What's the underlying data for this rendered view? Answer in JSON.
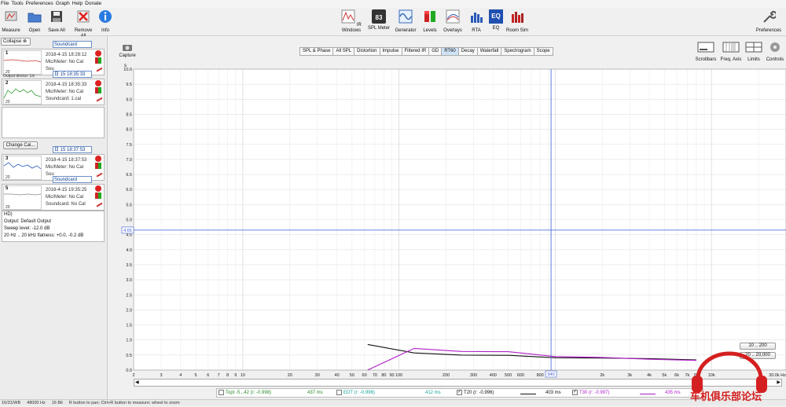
{
  "menu": [
    "File",
    "Tools",
    "Preferences",
    "Graph",
    "Help",
    "Donate"
  ],
  "toolbar_left": [
    {
      "label": "Measure",
      "icon": "microphone-icon"
    },
    {
      "label": "Open",
      "icon": "open-folder-icon"
    },
    {
      "label": "Save All",
      "icon": "save-icon"
    },
    {
      "label": "Remove All",
      "icon": "remove-all-icon"
    },
    {
      "label": "Info",
      "icon": "info-icon"
    }
  ],
  "toolbar_center": [
    {
      "label": "IR Windows",
      "icon": "ir-windows-icon"
    },
    {
      "label": "SPL Meter",
      "icon": "spl-meter-icon",
      "value": "83"
    },
    {
      "label": "Generator",
      "icon": "generator-icon"
    },
    {
      "label": "Levels",
      "icon": "levels-icon"
    },
    {
      "label": "Overlays",
      "icon": "overlays-icon"
    },
    {
      "label": "RTA",
      "icon": "rta-icon"
    },
    {
      "label": "EQ",
      "icon": "eq-icon"
    },
    {
      "label": "Room Sim",
      "icon": "room-sim-icon"
    }
  ],
  "preferences_label": "Preferences",
  "left_panel": {
    "collapse_label": "Collapse",
    "change_cal_label": "Change Cal...",
    "measurements": [
      {
        "num": "1",
        "date_input": "Soundcard",
        "date": "2018-4-15 18:28:12",
        "mic": "Mic/Meter: No Cal",
        "sound": "Sou",
        "thumb_lbl": "20",
        "extra": "Output device: Lin"
      },
      {
        "num": "2",
        "date_input": "日  15 18:35:33",
        "date": "2018-4-15 18:35:33",
        "mic": "Mic/Meter: No Cal",
        "sound": "Soundcard: 1.cal",
        "thumb_lbl": "20"
      },
      {
        "num": "3",
        "date_input": "日  15 18:37:53",
        "date": "2018-4-15 18:37:53",
        "mic": "Mic/Meter: No Cal",
        "sound": "Sou",
        "thumb_lbl": "20"
      },
      {
        "num": "5",
        "date_input": "Soundcard",
        "date": "2018-4-15 19:35:25",
        "mic": "Mic/Meter: No Cal",
        "sound": "Soundcard: No Cal",
        "thumb_lbl": "20"
      }
    ],
    "desc_lines": [
      "HD)",
      "Output: Default Output",
      "Sweep level: -12.0 dB",
      "20 Hz .. 20 kHz flatness: +0.0, -0.2 dB"
    ]
  },
  "capture_label": "Capture",
  "tabs": [
    "SPL & Phase",
    "All SPL",
    "Distortion",
    "Impulse",
    "Filtered IR",
    "GD",
    "RT60",
    "Decay",
    "Waterfall",
    "Spectrogram",
    "Scope"
  ],
  "active_tab": "RT60",
  "right_buttons": [
    "Scrollbars",
    "Freq. Axis",
    "Limits",
    "Controls"
  ],
  "zoom_buttons": [
    "10 .. 200",
    "20 .. 20,000"
  ],
  "chart_data": {
    "type": "line",
    "ylabel": "s",
    "ylim": [
      0,
      10
    ],
    "yticks": [
      "0.0",
      "0.5",
      "1.0",
      "1.5",
      "2.0",
      "2.5",
      "3.0",
      "3.5",
      "4.0",
      "4.5",
      "5.0",
      "5.5",
      "6.0",
      "6.5",
      "7.0",
      "7.5",
      "8.0",
      "8.5",
      "9.0",
      "9.5",
      "10.0"
    ],
    "xlim": [
      2,
      30000
    ],
    "xscale": "log",
    "xlabel_unit": "Hz",
    "xticks": [
      {
        "v": 2,
        "t": "2"
      },
      {
        "v": 3,
        "t": "3"
      },
      {
        "v": 4,
        "t": "4"
      },
      {
        "v": 5,
        "t": "5"
      },
      {
        "v": 6,
        "t": "6"
      },
      {
        "v": 7,
        "t": "7"
      },
      {
        "v": 8,
        "t": "8"
      },
      {
        "v": 9,
        "t": "9"
      },
      {
        "v": 10,
        "t": "10"
      },
      {
        "v": 20,
        "t": "20"
      },
      {
        "v": 30,
        "t": "30"
      },
      {
        "v": 40,
        "t": "40"
      },
      {
        "v": 50,
        "t": "50"
      },
      {
        "v": 60,
        "t": "60"
      },
      {
        "v": 70,
        "t": "70"
      },
      {
        "v": 80,
        "t": "80"
      },
      {
        "v": 90,
        "t": "90"
      },
      {
        "v": 100,
        "t": "100"
      },
      {
        "v": 200,
        "t": "200"
      },
      {
        "v": 300,
        "t": "300"
      },
      {
        "v": 400,
        "t": "400"
      },
      {
        "v": 500,
        "t": "500"
      },
      {
        "v": 600,
        "t": "600"
      },
      {
        "v": 800,
        "t": "800"
      },
      {
        "v": 2000,
        "t": "2k"
      },
      {
        "v": 3000,
        "t": "3k"
      },
      {
        "v": 4000,
        "t": "4k"
      },
      {
        "v": 5000,
        "t": "5k"
      },
      {
        "v": 6000,
        "t": "6k"
      },
      {
        "v": 7000,
        "t": "7k"
      },
      {
        "v": 8000,
        "t": "8k"
      },
      {
        "v": 10000,
        "t": "10k"
      },
      {
        "v": 30000,
        "t": "30.0k Hz"
      }
    ],
    "cursor": {
      "x_label": "940",
      "x_value": 940,
      "y_label": "4.65",
      "y_value": 4.65
    },
    "series": [
      {
        "name": "T20",
        "color": "#111111",
        "x": [
          63,
          125,
          250,
          500,
          1000,
          2000,
          4000,
          8000
        ],
        "y": [
          0.85,
          0.57,
          0.5,
          0.49,
          0.41,
          0.4,
          0.38,
          0.34
        ]
      },
      {
        "name": "T30",
        "color": "#b020c8",
        "x": [
          63,
          125,
          250,
          500,
          1000,
          2000,
          4000,
          8000
        ],
        "y": [
          0.0,
          0.72,
          0.62,
          0.61,
          0.45,
          0.42,
          0.36,
          0.32
        ]
      }
    ]
  },
  "legend": [
    {
      "label": "Topt -5...42 (r: -0.998)",
      "value": "437 ms",
      "checked": false,
      "color": "#2a8a2a"
    },
    {
      "label": "EDT (r: -0.996)",
      "value": "412 ms",
      "checked": false,
      "color": "#1aa39b"
    },
    {
      "label": "T20 (r: -0.996)",
      "value": "403 ms",
      "checked": true,
      "color": "#111111"
    },
    {
      "label": "T30 (r: -0.997)",
      "value": "435 ms",
      "checked": true,
      "color": "#b020c8"
    }
  ],
  "status": [
    "16/31/WB",
    "48000 Hz",
    "16 Bit",
    "R button to pan; Ctrl+R button to measure; wheel to zoom"
  ],
  "watermark": {
    "text": "车机俱乐部论坛",
    "color": "#d42020"
  }
}
